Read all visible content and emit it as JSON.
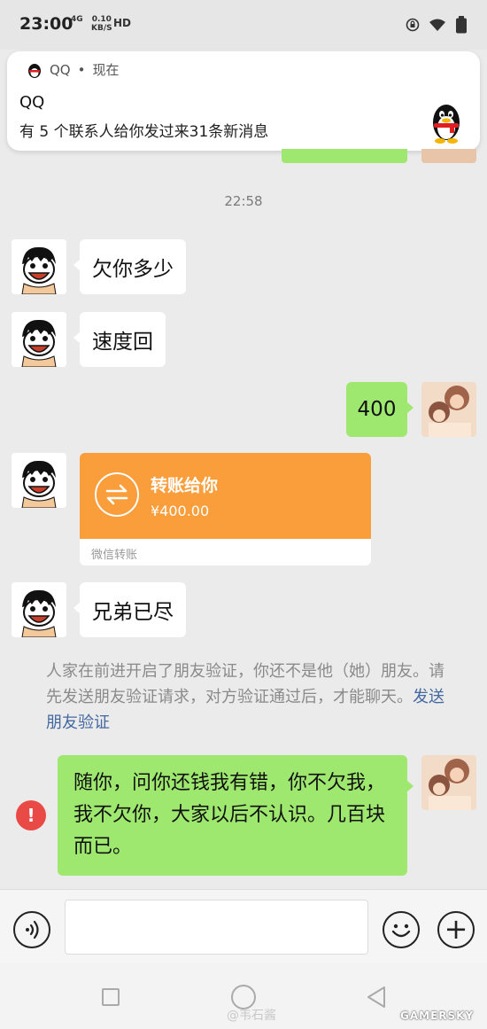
{
  "status_bar": {
    "time": "23:00",
    "network": "4G",
    "speed_value": "0.10",
    "speed_unit": "KB/S",
    "hd": "HD"
  },
  "notification": {
    "app_name": "QQ",
    "when": "现在",
    "title": "QQ",
    "body": "有 5 个联系人给你发过来31条新消息",
    "icon": "qq-penguin-icon"
  },
  "chat": {
    "timestamp": "22:58",
    "messages": [
      {
        "from": "other",
        "text": "欠你多少"
      },
      {
        "from": "other",
        "text": "速度回"
      },
      {
        "from": "me",
        "text": "400"
      },
      {
        "from": "other",
        "type": "transfer",
        "title": "转账给你",
        "amount": "¥400.00",
        "footer": "微信转账"
      },
      {
        "from": "other",
        "text": "兄弟已尽"
      }
    ],
    "system_notice": {
      "text": "人家在前进开启了朋友验证，你还不是他（她）朋友。请先发送朋友验证请求，对方验证通过后，才能聊天。",
      "link": "发送朋友验证"
    },
    "failed_message": {
      "text": "随你，问你还钱我有错，你不欠我，我不欠你，大家以后不认识。几百块而已。",
      "status_icon": "error-icon",
      "status_symbol": "!"
    }
  },
  "input_bar": {
    "voice_icon": "voice-icon",
    "emoji_icon": "emoji-icon",
    "plus_symbol": "+"
  },
  "watermarks": {
    "weibo": "@韦石酱",
    "site": "GAMERSKY"
  },
  "colors": {
    "my_bubble": "#9fe870",
    "transfer_orange": "#fa9d3b",
    "error_red": "#e94a45",
    "link_blue": "#4468a0"
  }
}
